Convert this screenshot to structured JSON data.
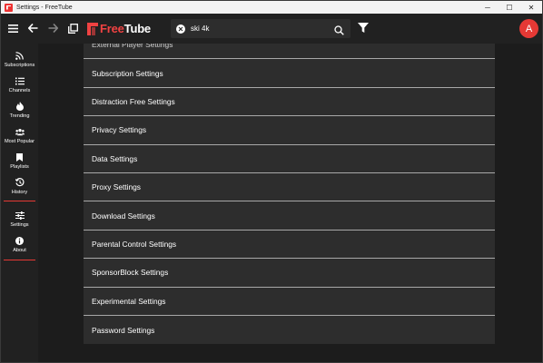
{
  "window": {
    "title": "Settings - FreeTube",
    "controls": {
      "minimize": "─",
      "maximize": "☐",
      "close": "✕"
    }
  },
  "logo": {
    "free": "Free",
    "tube": "Tube"
  },
  "search": {
    "value": "ski 4k"
  },
  "avatar": {
    "letter": "A",
    "color": "#e53935"
  },
  "sidebar": {
    "items": [
      {
        "label": "Subscriptions",
        "icon": "rss-icon"
      },
      {
        "label": "Channels",
        "icon": "list-icon"
      },
      {
        "label": "Trending",
        "icon": "fire-icon"
      },
      {
        "label": "Most Popular",
        "icon": "users-icon"
      },
      {
        "label": "Playlists",
        "icon": "bookmark-icon"
      },
      {
        "label": "History",
        "icon": "history-icon"
      },
      {
        "label": "Settings",
        "icon": "sliders-icon"
      },
      {
        "label": "About",
        "icon": "info-icon"
      }
    ]
  },
  "settings": {
    "items": [
      "External Player Settings",
      "Subscription Settings",
      "Distraction Free Settings",
      "Privacy Settings",
      "Data Settings",
      "Proxy Settings",
      "Download Settings",
      "Parental Control Settings",
      "SponsorBlock Settings",
      "Experimental Settings",
      "Password Settings"
    ]
  },
  "colors": {
    "accent": "#e53935",
    "panel": "#2d2d2d",
    "background": "#1c1c1c",
    "bar": "#212121"
  }
}
